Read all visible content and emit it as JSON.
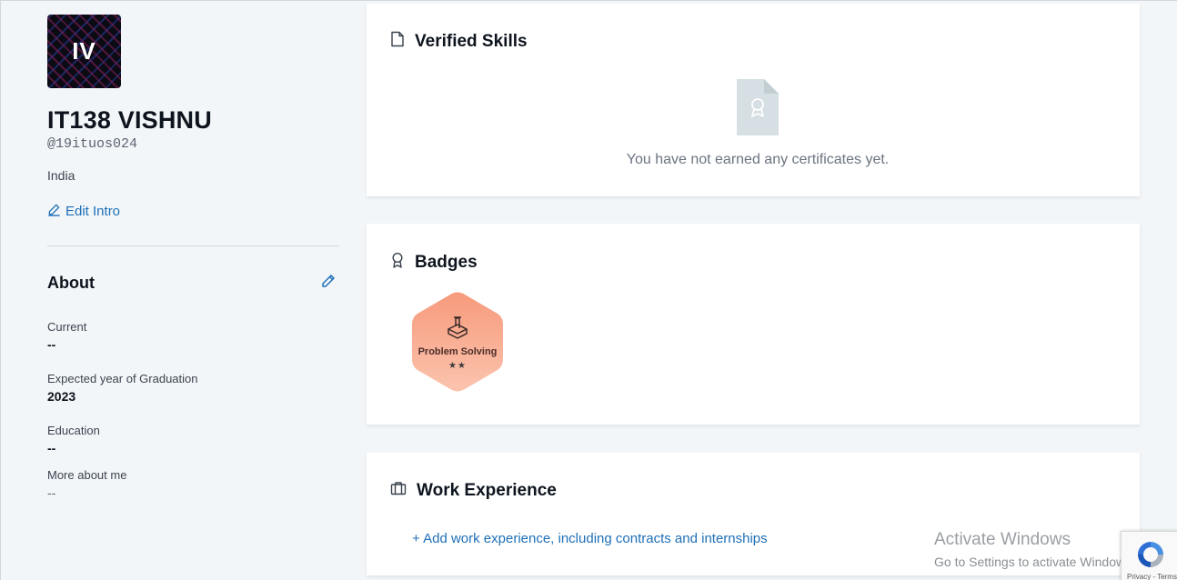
{
  "profile": {
    "avatar_initials": "IV",
    "name": "IT138 VISHNU",
    "handle": "@19ituos024",
    "country": "India",
    "edit_intro_label": "Edit Intro"
  },
  "about": {
    "title": "About",
    "fields": [
      {
        "label": "Current",
        "value": "--"
      },
      {
        "label": "Expected year of Graduation",
        "value": "2023"
      },
      {
        "label": "Education",
        "value": "--"
      },
      {
        "label": "More about me",
        "value": "--"
      }
    ]
  },
  "verified_skills": {
    "title": "Verified Skills",
    "empty_message": "You have not earned any certificates yet."
  },
  "badges": {
    "title": "Badges",
    "items": [
      {
        "label": "Problem Solving",
        "stars": "★★",
        "star_count": 2,
        "color": "#f7a48a"
      }
    ]
  },
  "work_experience": {
    "title": "Work Experience",
    "add_link": "+ Add work experience, including contracts and internships"
  },
  "watermark": {
    "title": "Activate Windows",
    "subtitle": "Go to Settings to activate Windows."
  },
  "recaptcha": {
    "links": "Privacy - Terms"
  },
  "colors": {
    "accent": "#1d6fb8",
    "background": "#f3f6f8",
    "badge": "#f7a48a"
  }
}
